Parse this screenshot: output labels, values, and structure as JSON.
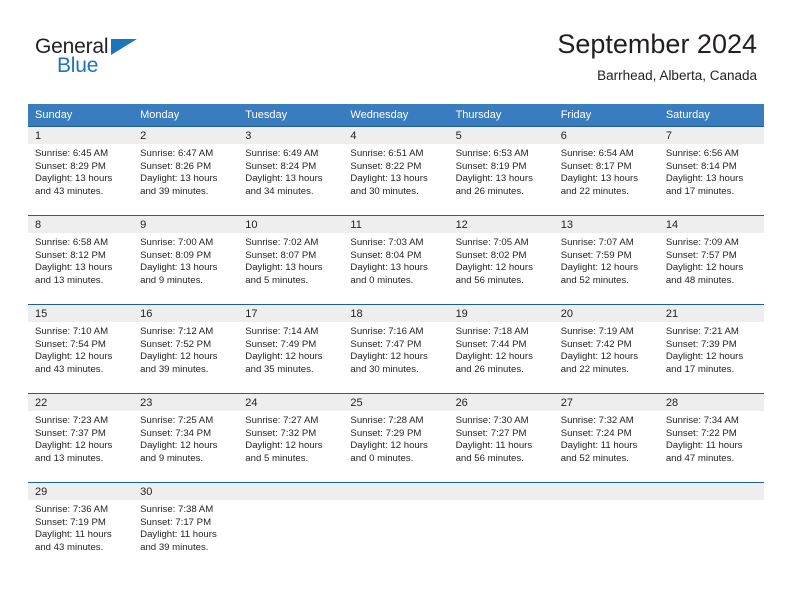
{
  "brand": {
    "name_dark": "General",
    "name_light": "Blue",
    "flag_icon": "triangle-flag-icon"
  },
  "header": {
    "title": "September 2024",
    "subtitle": "Barrhead, Alberta, Canada"
  },
  "colors": {
    "header_row_bg": "#3a7cc0",
    "cell_top_border": "#1b5fa0",
    "daynum_band_bg": "#eeeeee",
    "brand_blue": "#1b75bc",
    "text": "#231f20"
  },
  "calendar": {
    "weekday_headers": [
      "Sunday",
      "Monday",
      "Tuesday",
      "Wednesday",
      "Thursday",
      "Friday",
      "Saturday"
    ],
    "weeks": [
      [
        {
          "day": "1",
          "sunrise": "Sunrise: 6:45 AM",
          "sunset": "Sunset: 8:29 PM",
          "daylight_1": "Daylight: 13 hours",
          "daylight_2": "and 43 minutes."
        },
        {
          "day": "2",
          "sunrise": "Sunrise: 6:47 AM",
          "sunset": "Sunset: 8:26 PM",
          "daylight_1": "Daylight: 13 hours",
          "daylight_2": "and 39 minutes."
        },
        {
          "day": "3",
          "sunrise": "Sunrise: 6:49 AM",
          "sunset": "Sunset: 8:24 PM",
          "daylight_1": "Daylight: 13 hours",
          "daylight_2": "and 34 minutes."
        },
        {
          "day": "4",
          "sunrise": "Sunrise: 6:51 AM",
          "sunset": "Sunset: 8:22 PM",
          "daylight_1": "Daylight: 13 hours",
          "daylight_2": "and 30 minutes."
        },
        {
          "day": "5",
          "sunrise": "Sunrise: 6:53 AM",
          "sunset": "Sunset: 8:19 PM",
          "daylight_1": "Daylight: 13 hours",
          "daylight_2": "and 26 minutes."
        },
        {
          "day": "6",
          "sunrise": "Sunrise: 6:54 AM",
          "sunset": "Sunset: 8:17 PM",
          "daylight_1": "Daylight: 13 hours",
          "daylight_2": "and 22 minutes."
        },
        {
          "day": "7",
          "sunrise": "Sunrise: 6:56 AM",
          "sunset": "Sunset: 8:14 PM",
          "daylight_1": "Daylight: 13 hours",
          "daylight_2": "and 17 minutes."
        }
      ],
      [
        {
          "day": "8",
          "sunrise": "Sunrise: 6:58 AM",
          "sunset": "Sunset: 8:12 PM",
          "daylight_1": "Daylight: 13 hours",
          "daylight_2": "and 13 minutes."
        },
        {
          "day": "9",
          "sunrise": "Sunrise: 7:00 AM",
          "sunset": "Sunset: 8:09 PM",
          "daylight_1": "Daylight: 13 hours",
          "daylight_2": "and 9 minutes."
        },
        {
          "day": "10",
          "sunrise": "Sunrise: 7:02 AM",
          "sunset": "Sunset: 8:07 PM",
          "daylight_1": "Daylight: 13 hours",
          "daylight_2": "and 5 minutes."
        },
        {
          "day": "11",
          "sunrise": "Sunrise: 7:03 AM",
          "sunset": "Sunset: 8:04 PM",
          "daylight_1": "Daylight: 13 hours",
          "daylight_2": "and 0 minutes."
        },
        {
          "day": "12",
          "sunrise": "Sunrise: 7:05 AM",
          "sunset": "Sunset: 8:02 PM",
          "daylight_1": "Daylight: 12 hours",
          "daylight_2": "and 56 minutes."
        },
        {
          "day": "13",
          "sunrise": "Sunrise: 7:07 AM",
          "sunset": "Sunset: 7:59 PM",
          "daylight_1": "Daylight: 12 hours",
          "daylight_2": "and 52 minutes."
        },
        {
          "day": "14",
          "sunrise": "Sunrise: 7:09 AM",
          "sunset": "Sunset: 7:57 PM",
          "daylight_1": "Daylight: 12 hours",
          "daylight_2": "and 48 minutes."
        }
      ],
      [
        {
          "day": "15",
          "sunrise": "Sunrise: 7:10 AM",
          "sunset": "Sunset: 7:54 PM",
          "daylight_1": "Daylight: 12 hours",
          "daylight_2": "and 43 minutes."
        },
        {
          "day": "16",
          "sunrise": "Sunrise: 7:12 AM",
          "sunset": "Sunset: 7:52 PM",
          "daylight_1": "Daylight: 12 hours",
          "daylight_2": "and 39 minutes."
        },
        {
          "day": "17",
          "sunrise": "Sunrise: 7:14 AM",
          "sunset": "Sunset: 7:49 PM",
          "daylight_1": "Daylight: 12 hours",
          "daylight_2": "and 35 minutes."
        },
        {
          "day": "18",
          "sunrise": "Sunrise: 7:16 AM",
          "sunset": "Sunset: 7:47 PM",
          "daylight_1": "Daylight: 12 hours",
          "daylight_2": "and 30 minutes."
        },
        {
          "day": "19",
          "sunrise": "Sunrise: 7:18 AM",
          "sunset": "Sunset: 7:44 PM",
          "daylight_1": "Daylight: 12 hours",
          "daylight_2": "and 26 minutes."
        },
        {
          "day": "20",
          "sunrise": "Sunrise: 7:19 AM",
          "sunset": "Sunset: 7:42 PM",
          "daylight_1": "Daylight: 12 hours",
          "daylight_2": "and 22 minutes."
        },
        {
          "day": "21",
          "sunrise": "Sunrise: 7:21 AM",
          "sunset": "Sunset: 7:39 PM",
          "daylight_1": "Daylight: 12 hours",
          "daylight_2": "and 17 minutes."
        }
      ],
      [
        {
          "day": "22",
          "sunrise": "Sunrise: 7:23 AM",
          "sunset": "Sunset: 7:37 PM",
          "daylight_1": "Daylight: 12 hours",
          "daylight_2": "and 13 minutes."
        },
        {
          "day": "23",
          "sunrise": "Sunrise: 7:25 AM",
          "sunset": "Sunset: 7:34 PM",
          "daylight_1": "Daylight: 12 hours",
          "daylight_2": "and 9 minutes."
        },
        {
          "day": "24",
          "sunrise": "Sunrise: 7:27 AM",
          "sunset": "Sunset: 7:32 PM",
          "daylight_1": "Daylight: 12 hours",
          "daylight_2": "and 5 minutes."
        },
        {
          "day": "25",
          "sunrise": "Sunrise: 7:28 AM",
          "sunset": "Sunset: 7:29 PM",
          "daylight_1": "Daylight: 12 hours",
          "daylight_2": "and 0 minutes."
        },
        {
          "day": "26",
          "sunrise": "Sunrise: 7:30 AM",
          "sunset": "Sunset: 7:27 PM",
          "daylight_1": "Daylight: 11 hours",
          "daylight_2": "and 56 minutes."
        },
        {
          "day": "27",
          "sunrise": "Sunrise: 7:32 AM",
          "sunset": "Sunset: 7:24 PM",
          "daylight_1": "Daylight: 11 hours",
          "daylight_2": "and 52 minutes."
        },
        {
          "day": "28",
          "sunrise": "Sunrise: 7:34 AM",
          "sunset": "Sunset: 7:22 PM",
          "daylight_1": "Daylight: 11 hours",
          "daylight_2": "and 47 minutes."
        }
      ],
      [
        {
          "day": "29",
          "sunrise": "Sunrise: 7:36 AM",
          "sunset": "Sunset: 7:19 PM",
          "daylight_1": "Daylight: 11 hours",
          "daylight_2": "and 43 minutes."
        },
        {
          "day": "30",
          "sunrise": "Sunrise: 7:38 AM",
          "sunset": "Sunset: 7:17 PM",
          "daylight_1": "Daylight: 11 hours",
          "daylight_2": "and 39 minutes."
        },
        {
          "day": "",
          "sunrise": "",
          "sunset": "",
          "daylight_1": "",
          "daylight_2": ""
        },
        {
          "day": "",
          "sunrise": "",
          "sunset": "",
          "daylight_1": "",
          "daylight_2": ""
        },
        {
          "day": "",
          "sunrise": "",
          "sunset": "",
          "daylight_1": "",
          "daylight_2": ""
        },
        {
          "day": "",
          "sunrise": "",
          "sunset": "",
          "daylight_1": "",
          "daylight_2": ""
        },
        {
          "day": "",
          "sunrise": "",
          "sunset": "",
          "daylight_1": "",
          "daylight_2": ""
        }
      ]
    ]
  }
}
